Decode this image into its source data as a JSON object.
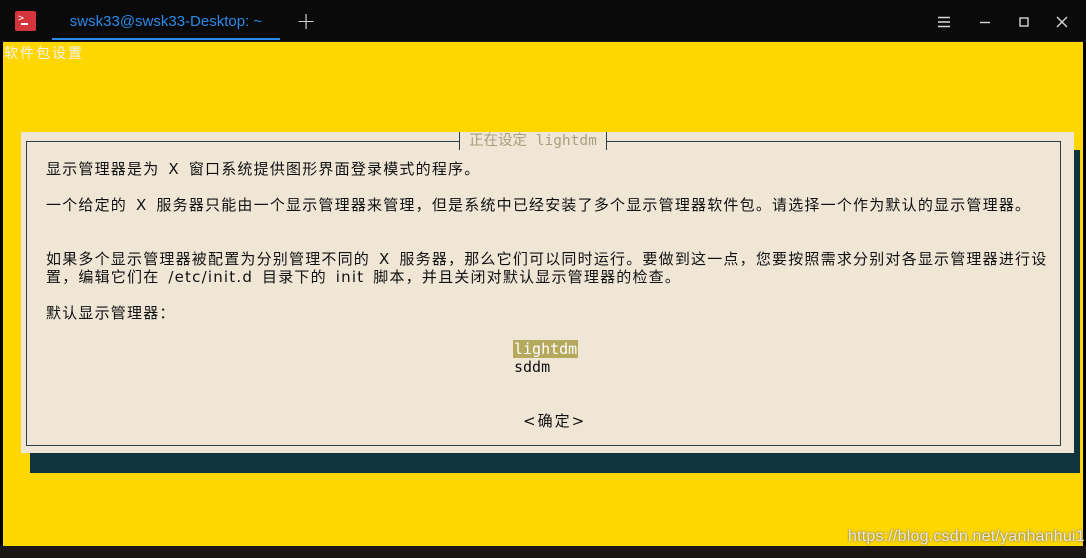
{
  "window": {
    "tab_title": "swsk33@swsk33-Desktop: ~",
    "add_tab": "+"
  },
  "terminal": {
    "top_title": "软件包设置",
    "dialog": {
      "title": "正在设定 lightdm",
      "paragraphs": [
        "显示管理器是为 X 窗口系统提供图形界面登录模式的程序。",
        "一个给定的 X 服务器只能由一个显示管理器来管理，但是系统中已经安装了多个显示管理器软件包。请选择一个作为默认的显示管理器。",
        "如果多个显示管理器被配置为分别管理不同的 X 服务器，那么它们可以同时运行。要做到这一点，您要按照需求分别对各显示管理器进行设置，编辑它们在 /etc/init.d 目录下的 init 脚本，并且关闭对默认显示管理器的检查。",
        "默认显示管理器："
      ],
      "options": [
        "lightdm",
        "sddm"
      ],
      "selected_option": "lightdm",
      "ok_button": "<确定>"
    }
  },
  "watermark": "https://blog.csdn.net/yanhanhui1",
  "colors": {
    "terminal_bg": "#ffd700",
    "dialog_bg": "#efe6d6",
    "dialog_shadow": "#0f3440",
    "selection": "#b5a95e",
    "tab_accent": "#2a8ae8",
    "app_icon": "#d4343b"
  }
}
